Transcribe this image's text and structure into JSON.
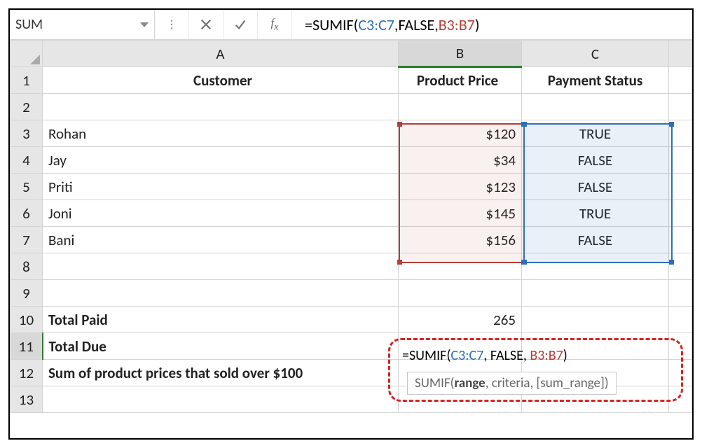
{
  "name_box": "SUM",
  "formula_bar": {
    "prefix": "=",
    "fn": "SUMIF",
    "open": "(",
    "arg1": "C3:C7",
    "sep1": ", ",
    "arg2": "FALSE",
    "sep2": ", ",
    "arg3": "B3:B7",
    "close": ")"
  },
  "columns": {
    "A": "A",
    "B": "B",
    "C": "C"
  },
  "headers": {
    "A": "Customer",
    "B": "Product Price",
    "C": "Payment Status"
  },
  "rows": {
    "r3": {
      "a": "Rohan",
      "b": "$120",
      "c": "TRUE"
    },
    "r4": {
      "a": "Jay",
      "b": "$34",
      "c": "FALSE"
    },
    "r5": {
      "a": "Priti",
      "b": "$123",
      "c": "FALSE"
    },
    "r6": {
      "a": "Joni",
      "b": "$145",
      "c": "TRUE"
    },
    "r7": {
      "a": "Bani",
      "b": "$156",
      "c": "FALSE"
    }
  },
  "totals": {
    "paid_label": "Total Paid",
    "paid_value": "265",
    "due_label": "Total Due",
    "sum100_label": "Sum of product prices that sold over $100"
  },
  "cell_formula": {
    "prefix": "=",
    "fn": "SUMIF",
    "open": "(",
    "arg1": "C3:C7",
    "sep1": ", ",
    "arg2": "FALSE",
    "sep2": ", ",
    "arg3": "B3:B7",
    "close": ")"
  },
  "tooltip": {
    "fn": "SUMIF(",
    "p1": "range",
    "sep1": ", ",
    "p2": "criteria",
    "sep2": ", ",
    "p3": "[sum_range]",
    "close": ")"
  },
  "row_nums": {
    "1": "1",
    "2": "2",
    "3": "3",
    "4": "4",
    "5": "5",
    "6": "6",
    "7": "7",
    "8": "8",
    "9": "9",
    "10": "10",
    "11": "11",
    "12": "12",
    "13": "13"
  },
  "chart_data": {
    "type": "table",
    "columns": [
      "Customer",
      "Product Price",
      "Payment Status"
    ],
    "rows": [
      [
        "Rohan",
        120,
        true
      ],
      [
        "Jay",
        34,
        false
      ],
      [
        "Priti",
        123,
        false
      ],
      [
        "Joni",
        145,
        true
      ],
      [
        "Bani",
        156,
        false
      ]
    ],
    "totals": {
      "Total Paid": 265
    },
    "formula_in_B11": "=SUMIF(C3:C7, FALSE, B3:B7)"
  }
}
